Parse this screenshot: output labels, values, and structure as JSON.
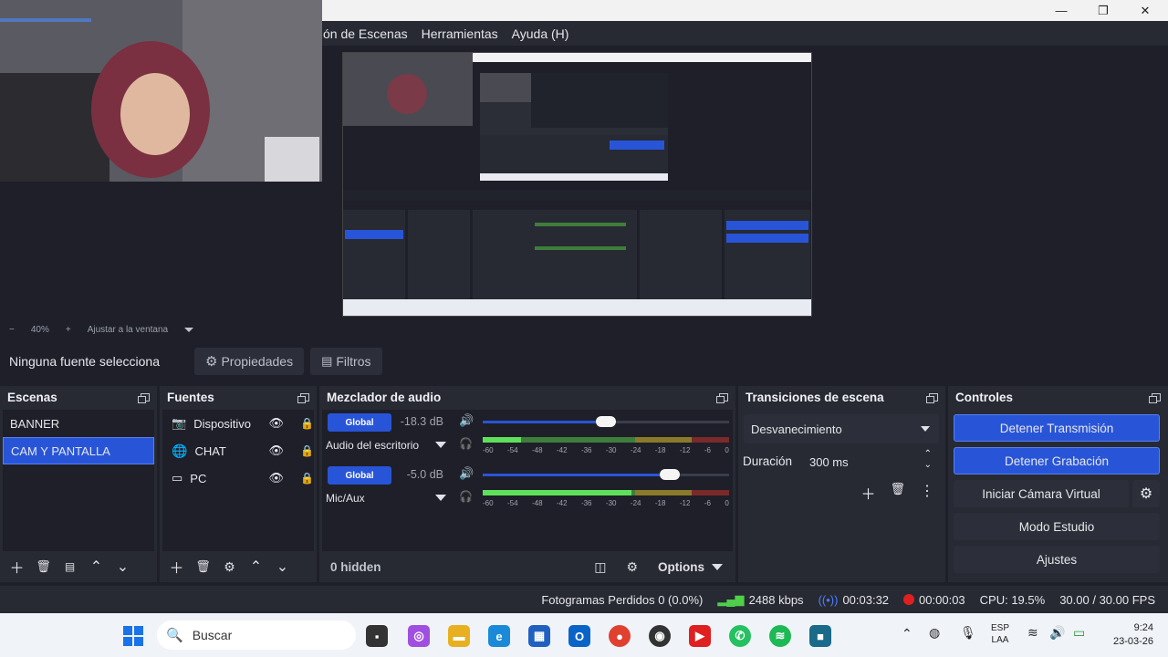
{
  "menu": {
    "items": [
      "ón de Escenas",
      "Herramientas",
      "Ayuda (H)"
    ]
  },
  "window": {
    "minimize": "—",
    "maximize": "❐",
    "close": "✕"
  },
  "zoom": {
    "minus": "−",
    "level": "40%",
    "plus": "+",
    "fit_label": "Ajustar a la ventana"
  },
  "context": {
    "no_source": "Ninguna fuente selecciona",
    "properties": "Propiedades",
    "filters": "Filtros"
  },
  "scenes": {
    "title": "Escenas",
    "items": [
      {
        "label": "BANNER",
        "selected": false
      },
      {
        "label": "CAM Y PANTALLA",
        "selected": true
      }
    ]
  },
  "sources": {
    "title": "Fuentes",
    "items": [
      {
        "label": "Dispositivo d",
        "icon": "camera-icon"
      },
      {
        "label": "CHAT",
        "icon": "globe-icon"
      },
      {
        "label": "PC",
        "icon": "monitor-icon"
      }
    ]
  },
  "mixer": {
    "title": "Mezclador de audio",
    "channels": [
      {
        "tag": "Global",
        "db": "-18.3 dB",
        "name": "Audio del escritorio",
        "volume": 0.5,
        "level": 0.22
      },
      {
        "tag": "Global",
        "db": "-5.0 dB",
        "name": "Mic/Aux",
        "volume": 0.76,
        "level": 0.86
      }
    ],
    "ticks": [
      "-60",
      "-54",
      "-48",
      "-42",
      "-36",
      "-30",
      "-24",
      "-18",
      "-12",
      "-6",
      "0"
    ],
    "hidden": "0 hidden",
    "options": "Options"
  },
  "transitions": {
    "title": "Transiciones de escena",
    "selected": "Desvanecimiento",
    "duration_label": "Duración",
    "duration_value": "300 ms"
  },
  "controls": {
    "title": "Controles",
    "stop_stream": "Detener Transmisión",
    "stop_record": "Detener Grabación",
    "virtual_cam": "Iniciar Cámara Virtual",
    "studio_mode": "Modo Estudio",
    "settings": "Ajustes"
  },
  "status": {
    "dropped": "Fotogramas Perdidos 0 (0.0%)",
    "bitrate": "2488 kbps",
    "stream_time": "00:03:32",
    "rec_time": "00:00:03",
    "cpu": "CPU: 19.5%",
    "fps": "30.00 / 30.00 FPS"
  },
  "taskbar": {
    "search": "Buscar",
    "lang_top": "ESP",
    "lang_bottom": "LAA",
    "time": "9:24",
    "date": "23-03-26"
  },
  "colors": {
    "accent": "#2855d8",
    "panel": "#272a33",
    "background": "#1e1f29"
  }
}
